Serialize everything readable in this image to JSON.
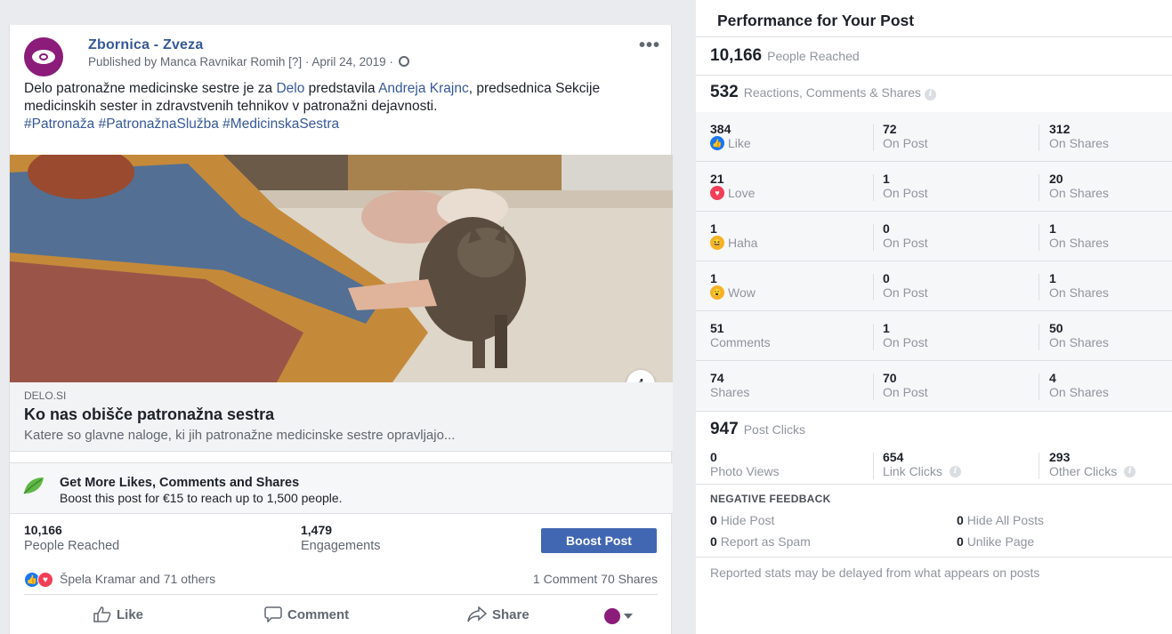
{
  "post": {
    "page_name": "Zbornica - Zveza",
    "meta": "Published by Manca Ravnikar Romih [?] · April 24, 2019 ·",
    "more": "•••",
    "text_parts": {
      "p1": "Delo patronažne medicinske sestre je za ",
      "link1": "Delo",
      "p2": " predstavila ",
      "link2": "Andreja Krajnc",
      "p3": ", predsednica Sekcije medicinskih sester in zdravstvenih tehnikov v patronažni dejavnosti.",
      "hashtags": "#Patronaža #PatronažnaSlužba #MedicinskaSestra"
    },
    "link_preview": {
      "domain": "DELO.SI",
      "title": "Ko nas obišče patronažna sestra",
      "description": "Katere so glavne naloge, ki jih patronažne medicinske sestre opravljajo..."
    },
    "promo": {
      "title": "Get More Likes, Comments and Shares",
      "subtitle": "Boost this post for €15 to reach up to 1,500 people."
    },
    "stats": {
      "reached_value": "10,166",
      "reached_label": "People Reached",
      "engagements_value": "1,479",
      "engagements_label": "Engagements",
      "boost_button": "Boost Post"
    },
    "reactions_summary": {
      "names": "Špela Kramar and 71 others",
      "counts": "1 Comment  70 Shares"
    },
    "actions": {
      "like": "Like",
      "comment": "Comment",
      "share": "Share"
    }
  },
  "performance": {
    "title": "Performance for Your Post",
    "people_reached": {
      "value": "10,166",
      "label": "People Reached"
    },
    "reactions_total": {
      "value": "532",
      "label": "Reactions, Comments & Shares"
    },
    "rows": [
      {
        "icon": "like-icon",
        "total": "384",
        "label": "Like",
        "on_post": "72",
        "on_post_label": "On Post",
        "on_shares": "312",
        "on_shares_label": "On Shares"
      },
      {
        "icon": "love-icon",
        "total": "21",
        "label": "Love",
        "on_post": "1",
        "on_post_label": "On Post",
        "on_shares": "20",
        "on_shares_label": "On Shares"
      },
      {
        "icon": "haha-icon",
        "total": "1",
        "label": "Haha",
        "on_post": "0",
        "on_post_label": "On Post",
        "on_shares": "1",
        "on_shares_label": "On Shares"
      },
      {
        "icon": "wow-icon",
        "total": "1",
        "label": "Wow",
        "on_post": "0",
        "on_post_label": "On Post",
        "on_shares": "1",
        "on_shares_label": "On Shares"
      },
      {
        "icon": "",
        "total": "51",
        "label": "Comments",
        "on_post": "1",
        "on_post_label": "On Post",
        "on_shares": "50",
        "on_shares_label": "On Shares"
      },
      {
        "icon": "",
        "total": "74",
        "label": "Shares",
        "on_post": "70",
        "on_post_label": "On Post",
        "on_shares": "4",
        "on_shares_label": "On Shares"
      }
    ],
    "post_clicks": {
      "value": "947",
      "label": "Post Clicks"
    },
    "clicks": {
      "photo_views": "0",
      "photo_views_label": "Photo Views",
      "link_clicks": "654",
      "link_clicks_label": "Link Clicks",
      "other_clicks": "293",
      "other_clicks_label": "Other Clicks"
    },
    "negative": {
      "title": "NEGATIVE FEEDBACK",
      "hide_post": "0",
      "hide_post_label": "Hide Post",
      "hide_all": "0",
      "hide_all_label": "Hide All Posts",
      "spam": "0",
      "spam_label": "Report as Spam",
      "unlike": "0",
      "unlike_label": "Unlike Page"
    },
    "footnote": "Reported stats may be delayed from what appears on posts"
  },
  "colors": {
    "brand": "#8b1c7a",
    "link": "#365899",
    "boost": "#4267b2",
    "like": "#1877f2",
    "love": "#f33e58",
    "haha": "#f7b125"
  }
}
